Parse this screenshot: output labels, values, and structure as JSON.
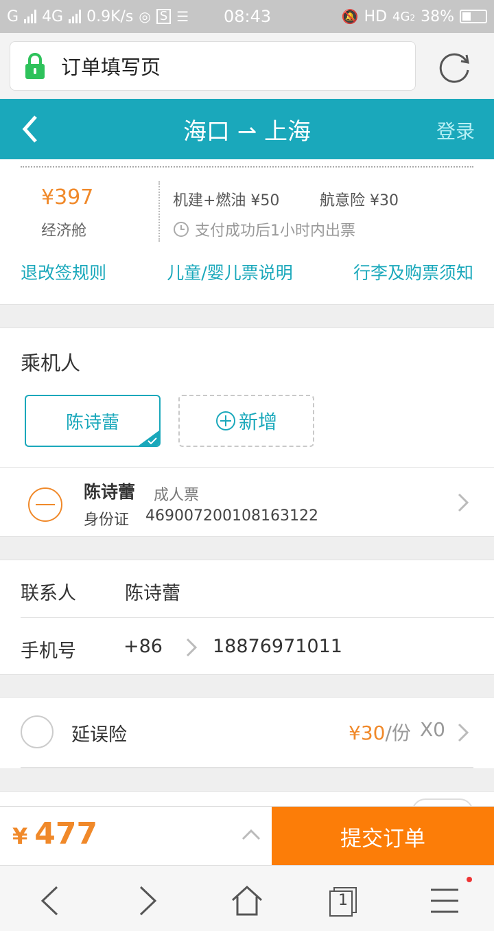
{
  "statusbar": {
    "carrier1": "G",
    "carrier2": "4G",
    "speed": "0.9K/s",
    "time": "08:43",
    "hd": "HD",
    "net": "4G",
    "net_sub": "2",
    "battery": "38%"
  },
  "browser": {
    "page_title": "订单填写页"
  },
  "header": {
    "title": "海口 ⇀ 上海",
    "login": "登录"
  },
  "fare": {
    "price": "¥397",
    "cabin": "经济舱",
    "fee": "机建+燃油 ¥50",
    "insurance": "航意险 ¥30",
    "issue_note": "支付成功后1小时内出票",
    "links": [
      "退改签规则",
      "儿童/婴儿票说明",
      "行李及购票须知"
    ]
  },
  "passengers": {
    "section_title": "乘机人",
    "selected_chip": "陈诗蕾",
    "add_label": "新增",
    "list": [
      {
        "name": "陈诗蕾",
        "ticket_type": "成人票",
        "id_type": "身份证",
        "id_number": "469007200108163122"
      }
    ]
  },
  "contact": {
    "contact_label": "联系人",
    "contact_value": "陈诗蕾",
    "phone_label": "手机号",
    "country_code": "+86",
    "phone_value": "18876971011"
  },
  "delay_insurance": {
    "name": "延误险",
    "price": "¥30",
    "unit": "/份",
    "count": "X0"
  },
  "paybar": {
    "currency": "¥",
    "total": "477",
    "submit_label": "提交订单"
  },
  "nav": {
    "tab_count": "1"
  },
  "colors": {
    "accent": "#1aa8bb",
    "price": "#f0892a",
    "submit": "#fc7d08"
  }
}
